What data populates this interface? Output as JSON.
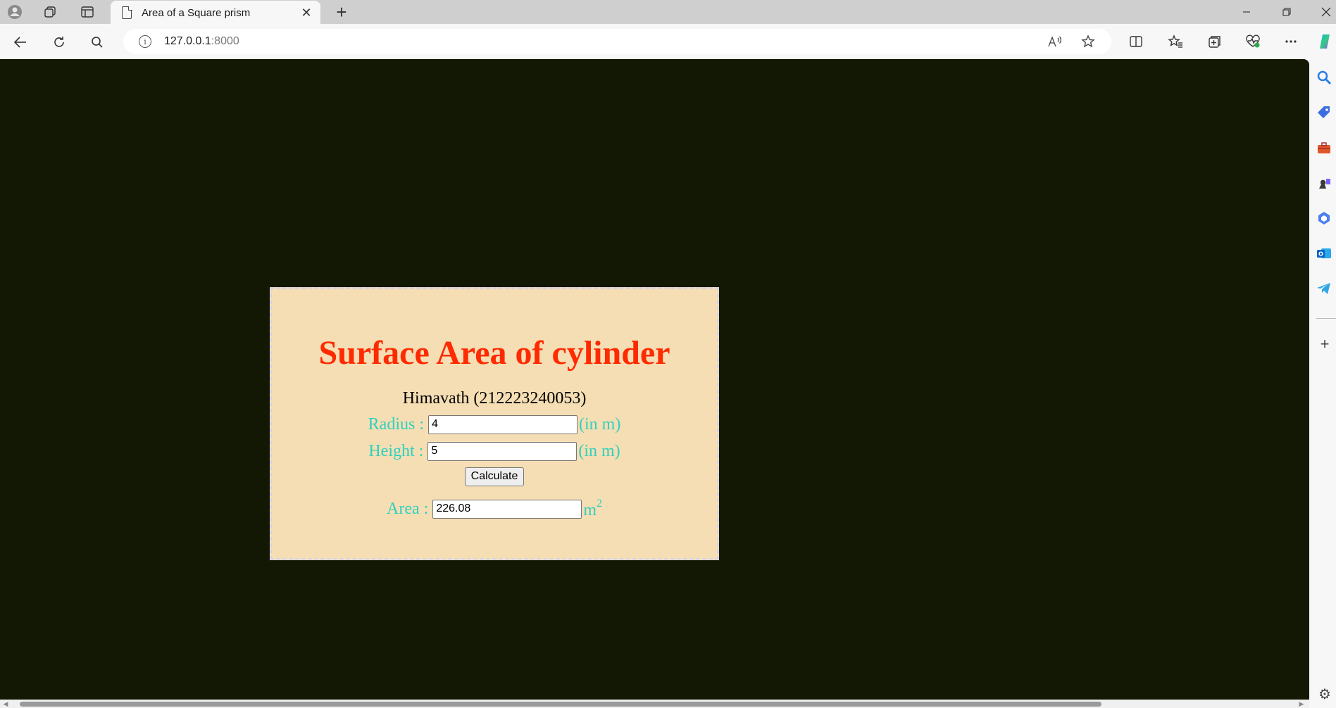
{
  "browser": {
    "tab_title": "Area of a Square prism",
    "url_host": "127.0.0.1",
    "url_port": ":8000",
    "tab_close_glyph": "✕",
    "new_tab_glyph": "+",
    "icons": {
      "profile": "profile-icon",
      "workspaces": "workspaces-icon",
      "tab_actions": "tab-actions-icon",
      "back": "back-arrow-icon",
      "refresh": "refresh-icon",
      "search": "search-icon",
      "info": "info-icon",
      "read_aloud": "read-aloud-icon",
      "favorite": "star-icon",
      "split_screen": "split-screen-icon",
      "favorites": "favorites-icon",
      "collections": "collections-icon",
      "browser_essentials": "heart-pulse-icon",
      "more": "more-icon",
      "copilot": "copilot-icon"
    },
    "sidebar_icons": [
      "search-icon",
      "shopping-tag-icon",
      "tools-icon",
      "games-icon",
      "microsoft365-icon",
      "outlook-icon",
      "telegram-icon"
    ]
  },
  "page": {
    "heading": "Surface Area of cylinder",
    "author": "Himavath (212223240053)",
    "radius": {
      "label": "Radius :",
      "value": "4",
      "unit": "(in m)"
    },
    "height": {
      "label": "Height :",
      "value": "5",
      "unit": "(in m)"
    },
    "calculate_label": "Calculate",
    "area": {
      "label": "Area :",
      "value": "226.08",
      "unit": "m",
      "unit_sup": "2"
    }
  },
  "colors": {
    "page_background": "#131805",
    "card_background": "#f5deb3",
    "heading": "#ff2a00",
    "label": "#2fd0c0"
  }
}
